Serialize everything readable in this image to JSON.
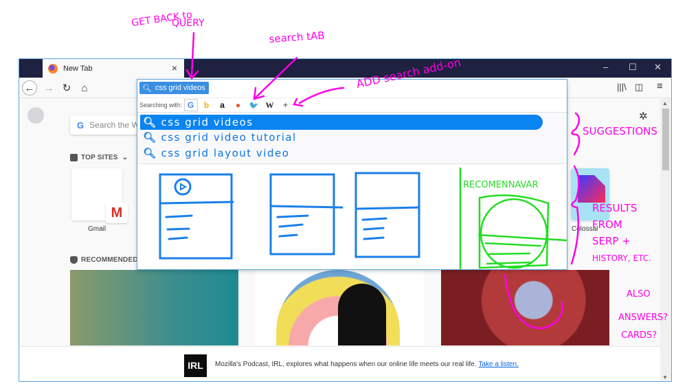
{
  "browser": {
    "tab_title": "New Tab",
    "tab_close": "×",
    "new_tab": "+",
    "window_controls": {
      "minimize": "–",
      "maximize": "☐",
      "close": "✕"
    },
    "nav": {
      "back": "←",
      "forward": "→",
      "reload": "↻",
      "home": "⌂"
    },
    "toolbar_right": {
      "library": "|||\\",
      "sidebar": "◫",
      "menu": "≡"
    }
  },
  "newtab": {
    "search_placeholder": "Search the W",
    "google_glyph": "G",
    "settings_icon": "✲",
    "top_sites_label": "TOP SITES",
    "top_sites_chevron": "⌄",
    "top_sites": [
      {
        "label": "Gmail",
        "icon": "M"
      },
      {
        "label": "Colossal"
      }
    ],
    "recommended_label": "RECOMMENDED",
    "banner": {
      "badge": "IRL",
      "text": "Mozilla's Podcast, IRL, explores what happens when our online life meets our real life.",
      "link": "Take a listen."
    }
  },
  "search_popup": {
    "query": "css grid videos",
    "searching_with_label": "Searching with:",
    "engines": [
      {
        "name": "google",
        "glyph": "G",
        "color": "#4285f4",
        "selected": true
      },
      {
        "name": "bing",
        "glyph": "b",
        "color": "#f5b400"
      },
      {
        "name": "amazon",
        "glyph": "a",
        "color": "#111111"
      },
      {
        "name": "duckduckgo",
        "glyph": "●",
        "color": "#de5833"
      },
      {
        "name": "twitter",
        "glyph": "🐦",
        "color": "#1da1f2"
      },
      {
        "name": "wikipedia",
        "glyph": "W",
        "color": "#222222"
      },
      {
        "name": "add-engine",
        "glyph": "+",
        "color": "#777777"
      }
    ],
    "suggestions": [
      {
        "text": "css grid videos",
        "highlighted": true
      },
      {
        "text": "css grid video tutorial",
        "highlighted": false
      },
      {
        "text": "css grid layout video",
        "highlighted": false
      }
    ],
    "recommendation_label": "RECOMENNAVAR"
  },
  "annotations": {
    "get_back": [
      "GET BACK to",
      "QUERY"
    ],
    "search_tab": "search tAB",
    "add_search": "ADD search add-on",
    "suggestions": "SUGGESTIONS",
    "results": [
      "RESULTS",
      "FROM",
      "SERP +",
      "HISTORY, ETC."
    ],
    "also": [
      "ALSO",
      "ANSWERS?",
      "CARDS?"
    ]
  },
  "colors": {
    "accent": "#0a84f0",
    "annotation": "#ff00e6",
    "sketch_blue": "#1a7fe8",
    "sketch_green": "#22dd22",
    "tabbar": "#1e2140"
  }
}
